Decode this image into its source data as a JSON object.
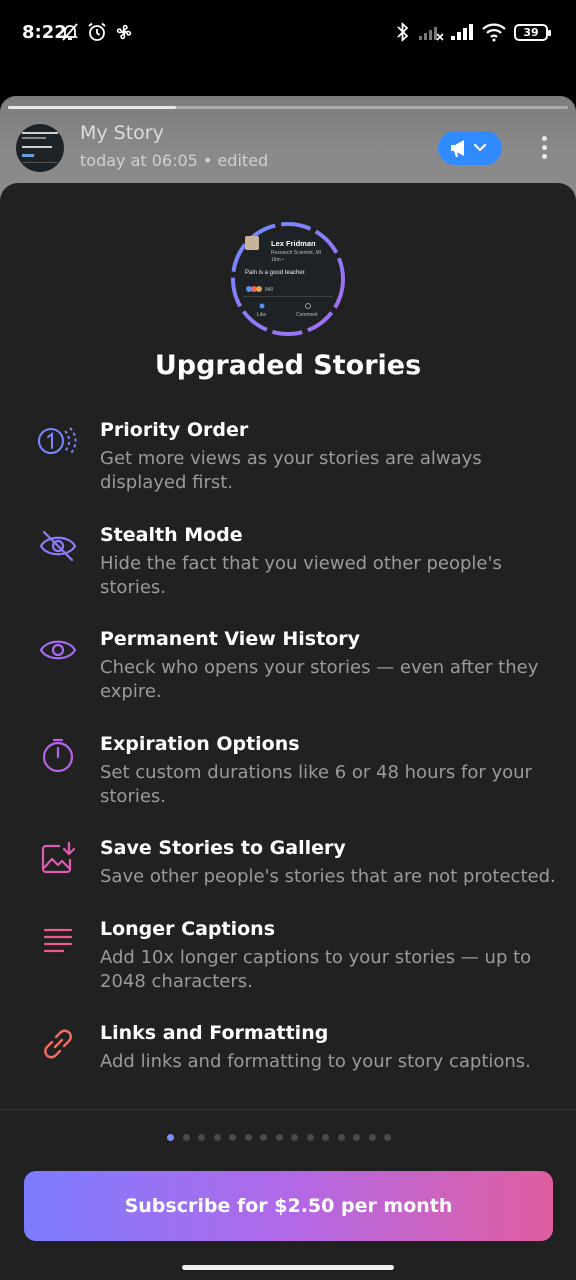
{
  "status": {
    "time": "8:22",
    "battery": "39"
  },
  "story": {
    "title": "My Story",
    "subtitle": "today at 06:05 • edited",
    "progress_fraction": 0.3
  },
  "hero": {
    "post_author": "Lex Fridman",
    "post_headline": "Research Scientist, MI",
    "post_time": "16m •",
    "post_text": "Pain is a good teacher.",
    "reaction_count": "840",
    "like_label": "Like",
    "comment_label": "Comment"
  },
  "sheet": {
    "title": "Upgraded Stories",
    "features": [
      {
        "icon": "priority-order-icon",
        "title": "Priority Order",
        "desc": "Get more views as your stories are always displayed first."
      },
      {
        "icon": "stealth-eye-off-icon",
        "title": "Stealth Mode",
        "desc": "Hide the fact that you viewed other people's stories."
      },
      {
        "icon": "eye-icon",
        "title": "Permanent View History",
        "desc": "Check who opens your stories — even after they expire."
      },
      {
        "icon": "timer-icon",
        "title": "Expiration Options",
        "desc": "Set custom durations like 6 or 48 hours for your stories."
      },
      {
        "icon": "save-to-gallery-icon",
        "title": "Save Stories to Gallery",
        "desc": "Save other people's stories that are not protected."
      },
      {
        "icon": "lines-icon",
        "title": "Longer Captions",
        "desc": "Add 10x longer captions to your stories — up to 2048 characters."
      },
      {
        "icon": "link-icon",
        "title": "Links and Formatting",
        "desc": "Add links and formatting to your story captions."
      }
    ],
    "page_indicator": {
      "count": 15,
      "current": 1
    },
    "subscribe_label": "Subscribe for $2.50 per month"
  },
  "colors": {
    "accent_blue": "#2f8bff",
    "sheet_bg": "#212121",
    "gradient_start": "#7c7cff",
    "gradient_end": "#e05ea0"
  }
}
